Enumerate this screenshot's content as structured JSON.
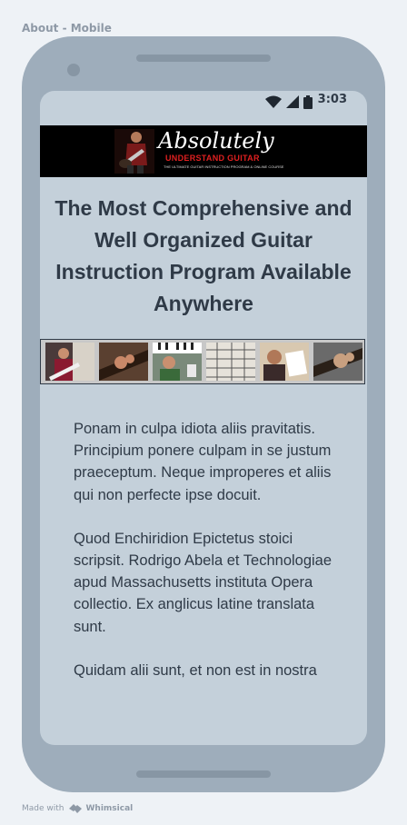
{
  "board": {
    "title": "About - Mobile"
  },
  "status_bar": {
    "time": "3:03",
    "icons": [
      "wifi-icon",
      "signal-icon",
      "battery-icon"
    ]
  },
  "banner": {
    "brand": "Absolutely",
    "subtitle": "UNDERSTAND GUITAR",
    "tagline": "THE ULTIMATE GUITAR INSTRUCTION PROGRAM & ONLINE COURSE"
  },
  "headline": "The Most Comprehensive and Well Organized Guitar Instruction Program Available Anywhere",
  "thumbnails": [
    "guitarist-photo",
    "fretboard-closeup-photo",
    "keyboard-lesson-photo",
    "sheet-music-photo",
    "instructor-notes-photo",
    "hand-on-fretboard-photo"
  ],
  "body": {
    "paragraphs": [
      "Ponam in culpa idiota aliis pravitatis. Principium ponere culpam in se justum praeceptum. Neque improperes et aliis qui non perfecte ipse docuit.",
      "Quod Enchiridion Epictetus stoici scripsit. Rodrigo Abela et Technologiae apud Massachusetts instituta Opera collectio. Ex anglicus latine translata sunt.",
      "Quidam alii sunt, et non est in nostra"
    ]
  },
  "footer": {
    "made_with": "Made with",
    "brand": "Whimsical"
  },
  "colors": {
    "phone": "#9eadbb",
    "screen": "#c4d0da",
    "text": "#2f3a47",
    "accent_red": "#e02020"
  }
}
